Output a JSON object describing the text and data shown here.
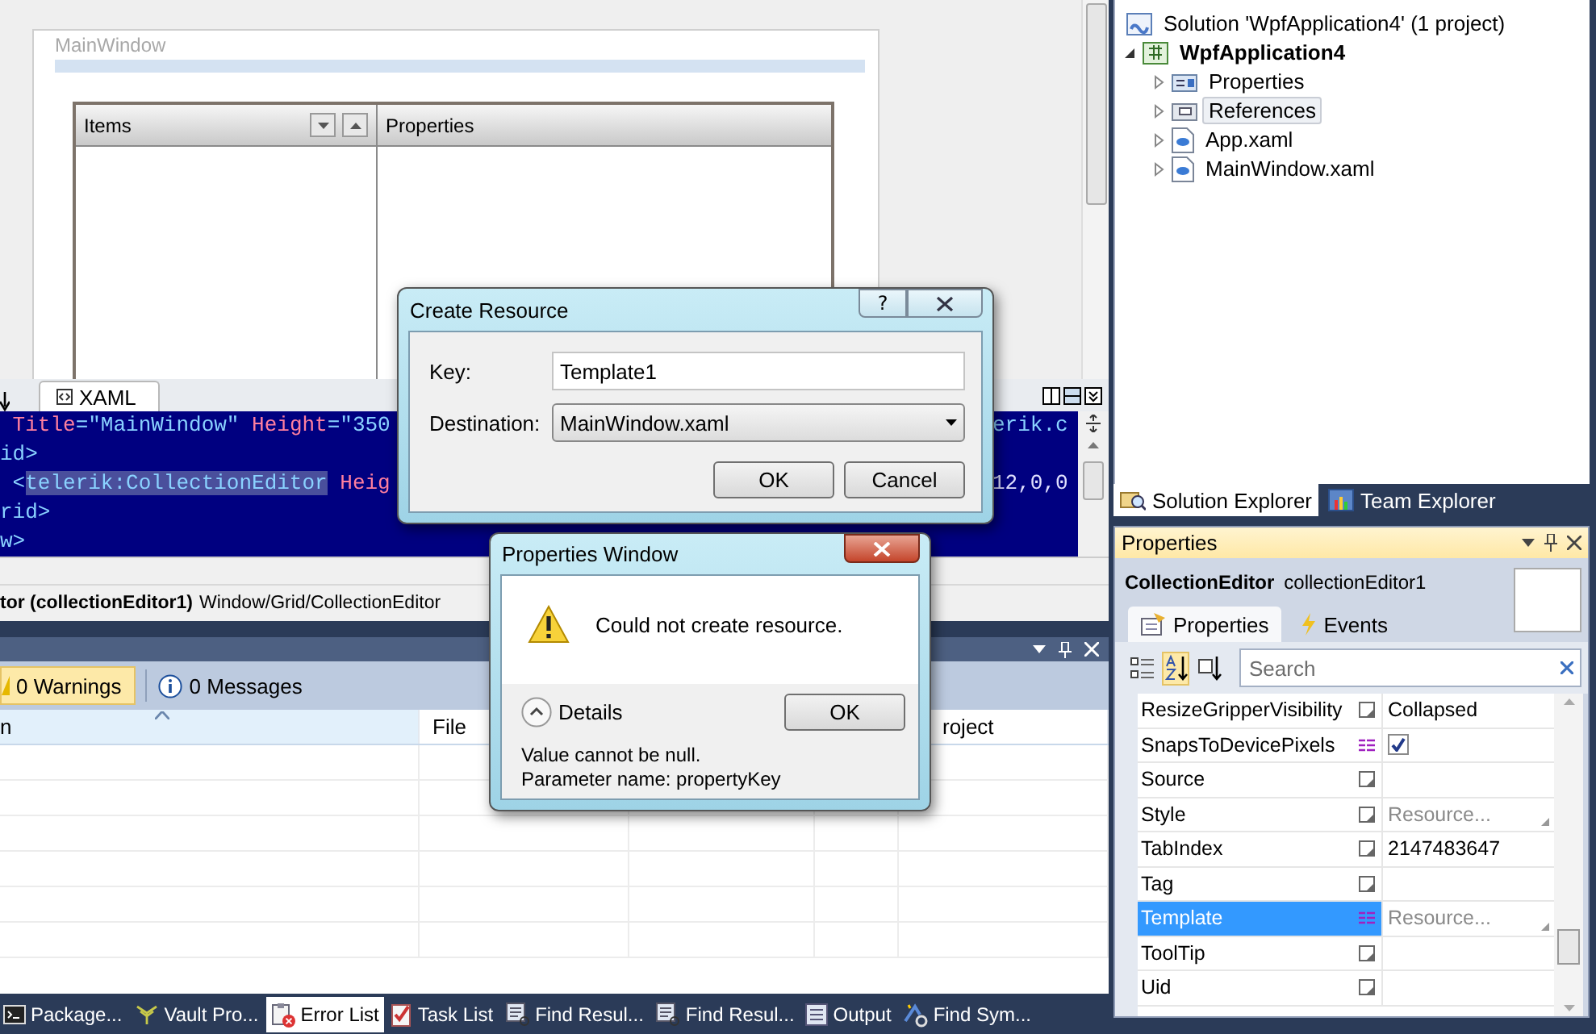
{
  "designer": {
    "window_title": "MainWindow",
    "columns": [
      {
        "label": "Items"
      },
      {
        "label": "Properties"
      }
    ]
  },
  "editor_tabs": [
    {
      "label": "XAML",
      "selected": true
    }
  ],
  "code": {
    "lines": [
      {
        "left": [
          {
            "text": " Title",
            "kind": "attr"
          },
          {
            "text": "=\"MainWindow\"",
            "kind": "value"
          },
          {
            "text": " Height",
            "kind": "attr"
          },
          {
            "text": "=\"350",
            "kind": "value"
          }
        ],
        "right": [
          {
            "text": "erik.c",
            "kind": "value"
          }
        ]
      },
      {
        "left": [
          {
            "text": "id>",
            "kind": "tag"
          }
        ]
      },
      {
        "left": [
          {
            "text": " <",
            "kind": "tag"
          },
          {
            "text": "telerik:CollectionEditor",
            "kind": "selection"
          },
          {
            "text": " Heig",
            "kind": "attr"
          }
        ],
        "right": [
          {
            "text": "12,0,0",
            "kind": "plain"
          }
        ]
      },
      {
        "left": [
          {
            "text": "rid>",
            "kind": "tag"
          }
        ]
      },
      {
        "left": [
          {
            "text": "w>",
            "kind": "tag"
          }
        ]
      }
    ]
  },
  "breadcrumb": {
    "element": "tor (collectionEditor1)",
    "path": "Window/Grid/CollectionEditor"
  },
  "error_list": {
    "filters": [
      {
        "label": "0 Warnings",
        "kind": "warning",
        "selected": true
      },
      {
        "label": "0 Messages",
        "kind": "info",
        "selected": false
      }
    ],
    "columns": [
      {
        "label": "n",
        "sorted": true
      },
      {
        "label": "File",
        "sorted": false
      },
      {
        "label": "roject",
        "sorted": false
      }
    ]
  },
  "bottom_tabs": [
    {
      "label": "Package...",
      "kind": "console",
      "selected": false
    },
    {
      "label": "Vault Pro...",
      "kind": "vault",
      "selected": false
    },
    {
      "label": "Error List",
      "kind": "errors",
      "selected": true
    },
    {
      "label": "Task List",
      "kind": "tasks",
      "selected": false
    },
    {
      "label": "Find Resul...",
      "kind": "find",
      "selected": false
    },
    {
      "label": "Find Resul...",
      "kind": "find",
      "selected": false
    },
    {
      "label": "Output",
      "kind": "output",
      "selected": false
    },
    {
      "label": "Find Sym...",
      "kind": "symbol",
      "selected": false
    }
  ],
  "solution_explorer": {
    "tree": [
      {
        "label": "Solution 'WpfApplication4' (1 project)",
        "kind": "solution",
        "selected": false,
        "children": [
          {
            "label": "WpfApplication4",
            "kind": "project",
            "expanded": true,
            "selected": false,
            "children": [
              {
                "label": "Properties",
                "kind": "properties",
                "expanded": false,
                "selected": false
              },
              {
                "label": "References",
                "kind": "references",
                "expanded": false,
                "selected": true
              },
              {
                "label": "App.xaml",
                "kind": "xaml",
                "expanded": false,
                "selected": false
              },
              {
                "label": "MainWindow.xaml",
                "kind": "xaml",
                "expanded": false,
                "selected": false
              }
            ]
          }
        ]
      }
    ],
    "tabs": [
      {
        "label": "Solution Explorer",
        "kind": "solution",
        "selected": true
      },
      {
        "label": "Team Explorer",
        "kind": "team",
        "selected": false
      }
    ]
  },
  "properties": {
    "title": "Properties",
    "type_name": "CollectionEditor",
    "instance_name": "collectionEditor1",
    "tabs": [
      {
        "label": "Properties",
        "kind": "properties",
        "selected": true
      },
      {
        "label": "Events",
        "kind": "events",
        "selected": false
      }
    ],
    "sort_buttons": [
      {
        "kind": "categorized",
        "selected": false
      },
      {
        "kind": "alphabetical",
        "selected": true
      },
      {
        "kind": "sources",
        "selected": false
      }
    ],
    "search": {
      "placeholder": "Search"
    },
    "rows": [
      {
        "name": "ResizeGripperVisibility",
        "bound": false,
        "kind": "text",
        "value": "Collapsed",
        "selected": false
      },
      {
        "name": "SnapsToDevicePixels",
        "bound": true,
        "kind": "checkbox",
        "checked": true,
        "selected": false
      },
      {
        "name": "Source",
        "bound": false,
        "kind": "text",
        "selected": false
      },
      {
        "name": "Style",
        "bound": false,
        "kind": "resource",
        "value": "Resource...",
        "selected": false
      },
      {
        "name": "TabIndex",
        "bound": false,
        "kind": "text",
        "value": "2147483647",
        "selected": false
      },
      {
        "name": "Tag",
        "bound": false,
        "kind": "text",
        "selected": false
      },
      {
        "name": "Template",
        "bound": true,
        "kind": "resource",
        "value": "Resource...",
        "selected": true
      },
      {
        "name": "ToolTip",
        "bound": false,
        "kind": "text",
        "selected": false
      },
      {
        "name": "Uid",
        "bound": false,
        "kind": "text",
        "selected": false
      }
    ]
  },
  "create_resource": {
    "title": "Create Resource",
    "help": "?",
    "key_label": "Key:",
    "key_value": "Template1",
    "destination_label": "Destination:",
    "destination_value": "MainWindow.xaml",
    "buttons": [
      "OK",
      "Cancel"
    ]
  },
  "error_dialog": {
    "title": "Properties Window",
    "message": "Could not create resource.",
    "details_label": "Details",
    "details_expanded": true,
    "button": "OK",
    "details": [
      "Value cannot be null.",
      "Parameter name: propertyKey"
    ]
  }
}
